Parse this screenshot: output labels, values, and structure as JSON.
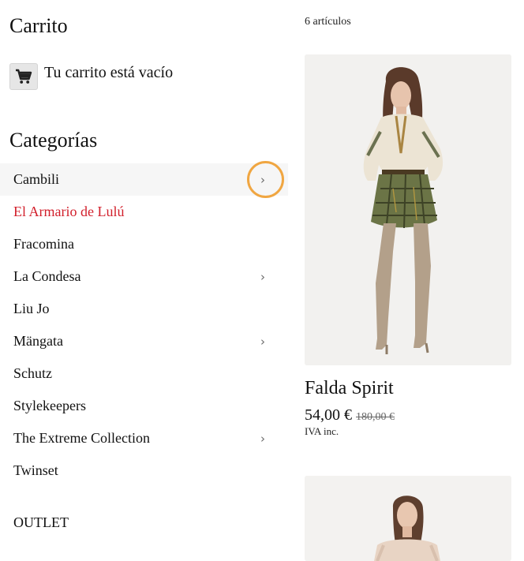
{
  "sidebar": {
    "cart": {
      "title": "Carrito",
      "empty_text": "Tu carrito está vacío",
      "icon": "cart-icon"
    },
    "categories": {
      "title": "Categorías",
      "items": [
        {
          "label": "Cambili",
          "has_children": true
        },
        {
          "label": "El Armario de Lulú",
          "has_children": false
        },
        {
          "label": "Fracomina",
          "has_children": false
        },
        {
          "label": "La Condesa",
          "has_children": true
        },
        {
          "label": "Liu Jo",
          "has_children": false
        },
        {
          "label": "Mängata",
          "has_children": true
        },
        {
          "label": "Schutz",
          "has_children": false
        },
        {
          "label": "Stylekeepers",
          "has_children": false
        },
        {
          "label": "The Extreme Collection",
          "has_children": true
        },
        {
          "label": "Twinset",
          "has_children": false
        }
      ],
      "chevron": "›",
      "highlight_color": "#d21f2b",
      "focus_ring_color": "#f0a641"
    },
    "outlet": "OUTLET"
  },
  "main": {
    "item_count": "6 artículos",
    "products": [
      {
        "name": "Falda Spirit",
        "price": "54,00 €",
        "old_price": "180,00 €",
        "tax": "IVA inc."
      }
    ]
  }
}
